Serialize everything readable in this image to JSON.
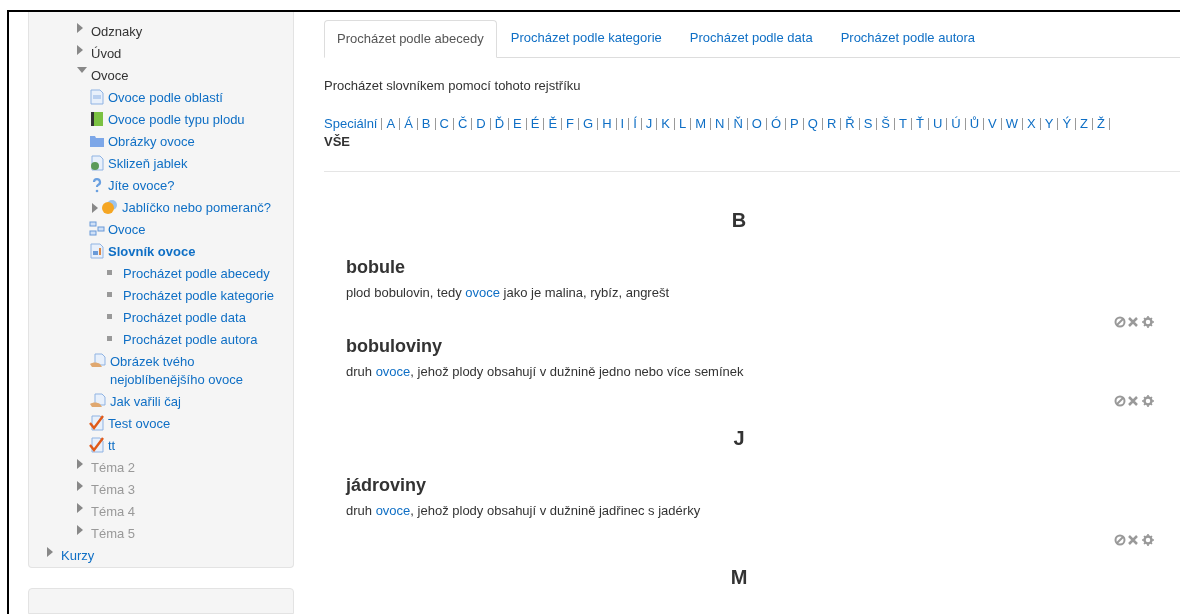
{
  "sidebar": {
    "items": [
      {
        "label": "Odznaky",
        "kind": "node",
        "expanded": false
      },
      {
        "label": "Úvod",
        "kind": "node",
        "expanded": false
      },
      {
        "label": "Ovoce",
        "kind": "node",
        "expanded": true,
        "children": [
          {
            "label": "Ovoce podle oblastí",
            "kind": "page"
          },
          {
            "label": "Ovoce podle typu plodu",
            "kind": "book"
          },
          {
            "label": "Obrázky ovoce",
            "kind": "folder"
          },
          {
            "label": "Sklizeň jablek",
            "kind": "url"
          },
          {
            "label": "Jíte ovoce?",
            "kind": "question"
          },
          {
            "label": "Jablíčko nebo pomeranč?",
            "kind": "forum",
            "expanded": false
          },
          {
            "label": "Ovoce",
            "kind": "tree"
          },
          {
            "label": "Slovník ovoce",
            "kind": "glossary",
            "selected": true,
            "children": [
              {
                "label": "Procházet podle abecedy",
                "kind": "bullet"
              },
              {
                "label": "Procházet podle kategorie",
                "kind": "bullet"
              },
              {
                "label": "Procházet podle data",
                "kind": "bullet"
              },
              {
                "label": "Procházet podle autora",
                "kind": "bullet"
              }
            ]
          },
          {
            "label": "Obrázek tvého nejoblíbenějšího ovoce",
            "kind": "assignment"
          },
          {
            "label": "Jak vařili čaj",
            "kind": "assignment"
          },
          {
            "label": "Test ovoce",
            "kind": "quiz"
          },
          {
            "label": "tt",
            "kind": "quiz"
          }
        ]
      },
      {
        "label": "Téma 2",
        "kind": "hidden",
        "expanded": false
      },
      {
        "label": "Téma 3",
        "kind": "hidden",
        "expanded": false
      },
      {
        "label": "Téma 4",
        "kind": "hidden",
        "expanded": false
      },
      {
        "label": "Téma 5",
        "kind": "hidden",
        "expanded": false
      },
      {
        "label": "Kurzy",
        "kind": "link",
        "expanded": false
      }
    ]
  },
  "tabs": [
    {
      "label": "Procházet podle abecedy",
      "selected": true
    },
    {
      "label": "Procházet podle kategorie",
      "selected": false
    },
    {
      "label": "Procházet podle data",
      "selected": false
    },
    {
      "label": "Procházet podle autora",
      "selected": false
    }
  ],
  "intro": "Procházet slovníkem pomocí tohoto rejstříku",
  "letters": [
    {
      "label": "Speciální",
      "selected": false
    },
    {
      "label": "A",
      "selected": false
    },
    {
      "label": "Á",
      "selected": false
    },
    {
      "label": "B",
      "selected": false
    },
    {
      "label": "C",
      "selected": false
    },
    {
      "label": "Č",
      "selected": false
    },
    {
      "label": "D",
      "selected": false
    },
    {
      "label": "Ď",
      "selected": false
    },
    {
      "label": "E",
      "selected": false
    },
    {
      "label": "É",
      "selected": false
    },
    {
      "label": "Ě",
      "selected": false
    },
    {
      "label": "F",
      "selected": false
    },
    {
      "label": "G",
      "selected": false
    },
    {
      "label": "H",
      "selected": false
    },
    {
      "label": "I",
      "selected": false
    },
    {
      "label": "Í",
      "selected": false
    },
    {
      "label": "J",
      "selected": false
    },
    {
      "label": "K",
      "selected": false
    },
    {
      "label": "L",
      "selected": false
    },
    {
      "label": "M",
      "selected": false
    },
    {
      "label": "N",
      "selected": false
    },
    {
      "label": "Ň",
      "selected": false
    },
    {
      "label": "O",
      "selected": false
    },
    {
      "label": "Ó",
      "selected": false
    },
    {
      "label": "P",
      "selected": false
    },
    {
      "label": "Q",
      "selected": false
    },
    {
      "label": "R",
      "selected": false
    },
    {
      "label": "Ř",
      "selected": false
    },
    {
      "label": "S",
      "selected": false
    },
    {
      "label": "Š",
      "selected": false
    },
    {
      "label": "T",
      "selected": false
    },
    {
      "label": "Ť",
      "selected": false
    },
    {
      "label": "U",
      "selected": false
    },
    {
      "label": "Ú",
      "selected": false
    },
    {
      "label": "Ů",
      "selected": false
    },
    {
      "label": "V",
      "selected": false
    },
    {
      "label": "W",
      "selected": false
    },
    {
      "label": "X",
      "selected": false
    },
    {
      "label": "Y",
      "selected": false
    },
    {
      "label": "Ý",
      "selected": false
    },
    {
      "label": "Z",
      "selected": false
    },
    {
      "label": "Ž",
      "selected": false
    },
    {
      "label": "VŠE",
      "selected": true
    }
  ],
  "groups": [
    {
      "letter": "B",
      "entries": [
        {
          "term": "bobule",
          "definition": {
            "before": "plod bobulovin, tedy ",
            "link": "ovoce",
            "after": " jako je malina, rybíz, angrešt"
          }
        },
        {
          "term": "bobuloviny",
          "definition": {
            "before": "druh ",
            "link": "ovoce",
            "after": ", jehož plody obsahují v dužnině jedno nebo více semínek"
          }
        }
      ]
    },
    {
      "letter": "J",
      "entries": [
        {
          "term": "jádroviny",
          "definition": {
            "before": "druh ",
            "link": "ovoce",
            "after": ", jehož plody obsahují v dužnině jadřinec s jadérky"
          }
        }
      ]
    },
    {
      "letter": "M"
    }
  ]
}
